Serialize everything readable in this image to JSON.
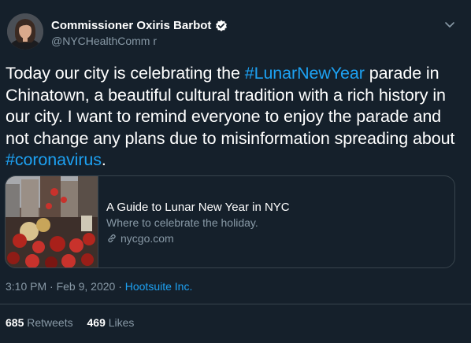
{
  "author": {
    "display_name": "Commissioner Oxiris Barbot",
    "handle": "@NYCHealthComm r",
    "verified": true,
    "avatar_icon": "profile-photo"
  },
  "tweet": {
    "lines": [
      [
        {
          "t": "Today our city is celebrating the "
        },
        {
          "t": "#LunarNewYear",
          "tag": true
        },
        {
          "t": " parade in"
        }
      ],
      [
        {
          "t": "Chinatown, a beautiful cultural tradition with a rich history in"
        }
      ],
      [
        {
          "t": "our city. I want to remind everyone to enjoy the parade and"
        }
      ],
      [
        {
          "t": "not change any plans due to misinformation spreading about"
        }
      ],
      [
        {
          "t": "#coronavirus",
          "tag": true
        },
        {
          "t": "."
        }
      ]
    ]
  },
  "card": {
    "title": "A Guide to Lunar New Year in NYC",
    "description": "Where to celebrate the holiday.",
    "domain": "nycgo.com",
    "image_icon": "parade-photo"
  },
  "meta": {
    "timestamp": "3:10 PM · Feb 9, 2020 · ",
    "source": "Hootsuite Inc."
  },
  "stats": {
    "retweets_count": "685",
    "retweets_label": "Retweets",
    "likes_count": "469",
    "likes_label": "Likes"
  },
  "colors": {
    "background": "#15202b",
    "accent": "#1da1f2",
    "secondary_text": "#8899a6",
    "border": "#38444d"
  }
}
